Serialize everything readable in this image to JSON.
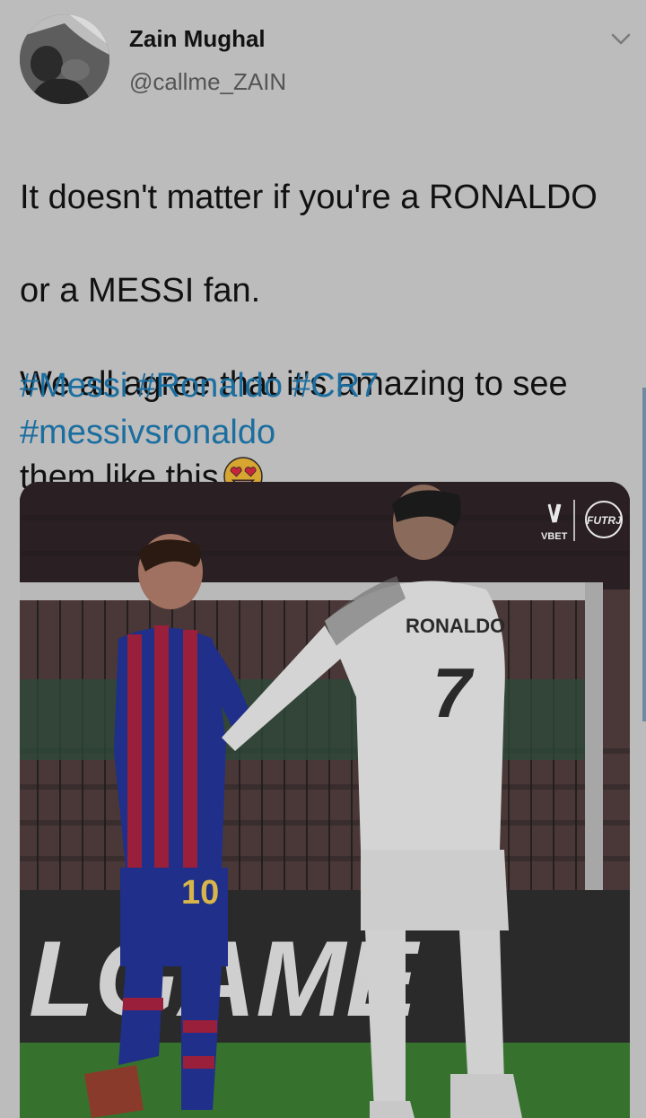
{
  "tweet": {
    "author": {
      "display_name": "Zain Mughal",
      "handle": "@callme_ZAIN",
      "avatar_icon": "profile-photo"
    },
    "menu_icon": "chevron-down-icon",
    "text_lines": [
      "It doesn't matter if you're a RONALDO",
      "or a MESSI fan.",
      "We all agree that it's amazing to see",
      "them like this"
    ],
    "emoji": "smiling-face-with-heart-eyes",
    "hashtags": [
      "#Messi",
      "#Ronaldo",
      "#CR7",
      "#messivsronaldo"
    ],
    "media": {
      "alt_subject": "photo",
      "jersey_name": "RONALDO",
      "jersey_number": "7",
      "other_number": "10",
      "board_text": "LGAME",
      "watermark_left": "VBET",
      "watermark_right": "FUTRJ"
    }
  },
  "colors": {
    "background": "#bcbcbc",
    "hashtag": "#1b6ea0",
    "text": "#111111"
  }
}
